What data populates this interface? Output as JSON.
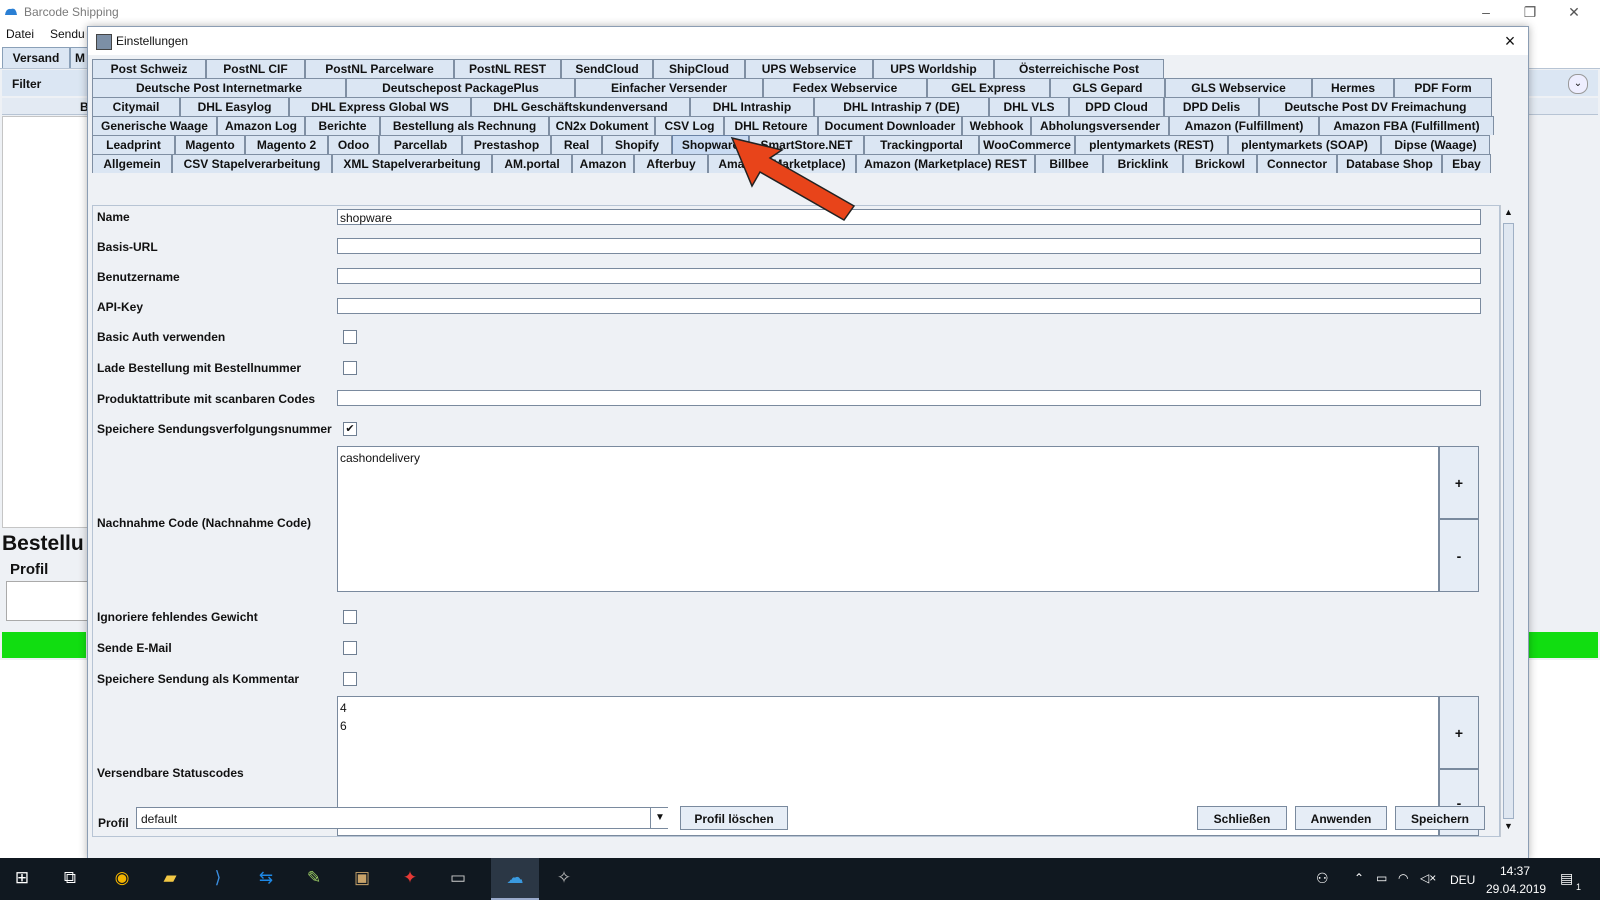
{
  "main_window": {
    "title": "Barcode Shipping",
    "menu": [
      "Datei",
      "Sendu"
    ],
    "tabs": [
      "Versand",
      "M"
    ],
    "filter_label": "Filter",
    "left_letter": "B",
    "section_title": "Bestellu",
    "profile_label": "Profil"
  },
  "dialog": {
    "title": "Einstellungen",
    "close_icon": "×",
    "tab_rows": [
      [
        "Post Schweiz",
        "PostNL CIF",
        "PostNL Parcelware",
        "PostNL REST",
        "SendCloud",
        "ShipCloud",
        "UPS Webservice",
        "UPS Worldship",
        "Österreichische Post"
      ],
      [
        "Deutsche Post Internetmarke",
        "Deutschepost PackagePlus",
        "Einfacher Versender",
        "Fedex Webservice",
        "GEL Express",
        "GLS Gepard",
        "GLS Webservice",
        "Hermes",
        "PDF Form"
      ],
      [
        "Citymail",
        "DHL Easylog",
        "DHL Express Global WS",
        "DHL Geschäftskundenversand",
        "DHL Intraship",
        "DHL Intraship 7 (DE)",
        "DHL VLS",
        "DPD Cloud",
        "DPD Delis",
        "Deutsche Post DV Freimachung"
      ],
      [
        "Generische Waage",
        "Amazon Log",
        "Berichte",
        "Bestellung als Rechnung",
        "CN2x Dokument",
        "CSV Log",
        "DHL Retoure",
        "Document Downloader",
        "Webhook",
        "Abholungsversender",
        "Amazon (Fulfillment)",
        "Amazon FBA (Fulfillment)"
      ],
      [
        "Leadprint",
        "Magento",
        "Magento 2",
        "Odoo",
        "Parcellab",
        "Prestashop",
        "Real",
        "Shopify",
        "Shopware",
        "SmartStore.NET",
        "Trackingportal",
        "WooCommerce",
        "plentymarkets (REST)",
        "plentymarkets (SOAP)",
        "Dipse (Waage)"
      ],
      [
        "Allgemein",
        "CSV Stapelverarbeitung",
        "XML Stapelverarbeitung",
        "AM.portal",
        "Amazon",
        "Afterbuy",
        "Amazon (Marketplace)",
        "Amazon (Marketplace) REST",
        "Billbee",
        "Bricklink",
        "Brickowl",
        "Connector",
        "Database Shop",
        "Ebay"
      ]
    ],
    "active_tab": "Shopware",
    "form": {
      "name_label": "Name",
      "name_value": "shopware",
      "base_url_label": "Basis-URL",
      "base_url_value": "",
      "username_label": "Benutzername",
      "username_value": "",
      "api_key_label": "API-Key",
      "api_key_value": "",
      "basic_auth_label": "Basic Auth verwenden",
      "basic_auth_checked": false,
      "load_order_label": "Lade Bestellung mit Bestellnummer",
      "load_order_checked": false,
      "product_attr_label": "Produktattribute mit scanbaren Codes",
      "product_attr_value": "",
      "save_tracking_label": "Speichere Sendungsverfolgungsnummer",
      "save_tracking_checked": true,
      "cod_label": "Nachnahme Code (Nachnahme Code)",
      "cod_value": "cashondelivery",
      "ignore_weight_label": "Ignoriere fehlendes Gewicht",
      "ignore_weight_checked": false,
      "send_email_label": "Sende E-Mail",
      "send_email_checked": false,
      "save_comment_label": "Speichere Sendung als Kommentar",
      "save_comment_checked": false,
      "status_codes_label": "Versendbare Statuscodes",
      "status_codes_value": "4\n6",
      "add_label": "+",
      "remove_label": "-"
    },
    "footer": {
      "profile_label": "Profil",
      "profile_value": "default",
      "delete_profile_label": "Profil löschen",
      "close_label": "Schließen",
      "apply_label": "Anwenden",
      "save_label": "Speichern"
    }
  },
  "taskbar": {
    "language": "DEU",
    "time": "14:37",
    "date": "29.04.2019",
    "notification_count": "1"
  },
  "colors": {
    "tab_bg": "#dbe6f3",
    "green_bar": "#11dd11",
    "arrow": "#e8441a",
    "taskbar": "#101820"
  }
}
